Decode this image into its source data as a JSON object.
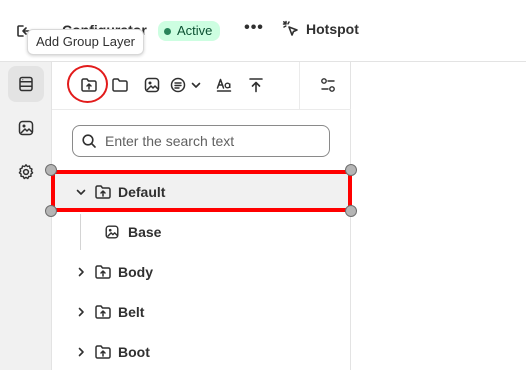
{
  "header": {
    "title": "Configurator",
    "status": "Active",
    "more_label": "•••",
    "hotspot_label": "Hotspot"
  },
  "tooltip": "Add Group Layer",
  "left_rail": {
    "items": [
      {
        "icon": "layers-icon",
        "active": true
      },
      {
        "icon": "image-icon",
        "active": false
      },
      {
        "icon": "gear-icon",
        "active": false
      }
    ]
  },
  "toolbar": {
    "icons": [
      "add-group-layer-icon",
      "folder-icon",
      "image-layer-icon",
      "text-layer-icon",
      "chevron-down-icon",
      "typography-icon",
      "upload-icon",
      "settings-sliders-icon"
    ]
  },
  "search": {
    "placeholder": "Enter the search text",
    "value": ""
  },
  "tree": {
    "items": [
      {
        "label": "Default",
        "kind": "group",
        "expanded": true,
        "selected": true
      },
      {
        "label": "Base",
        "kind": "image",
        "child": true
      },
      {
        "label": "Body",
        "kind": "group",
        "expanded": false
      },
      {
        "label": "Belt",
        "kind": "group",
        "expanded": false
      },
      {
        "label": "Boot",
        "kind": "group",
        "expanded": false
      }
    ]
  },
  "colors": {
    "accent_red": "#ff0000",
    "badge_bg": "#cdfee1",
    "badge_text": "#0c5132"
  }
}
